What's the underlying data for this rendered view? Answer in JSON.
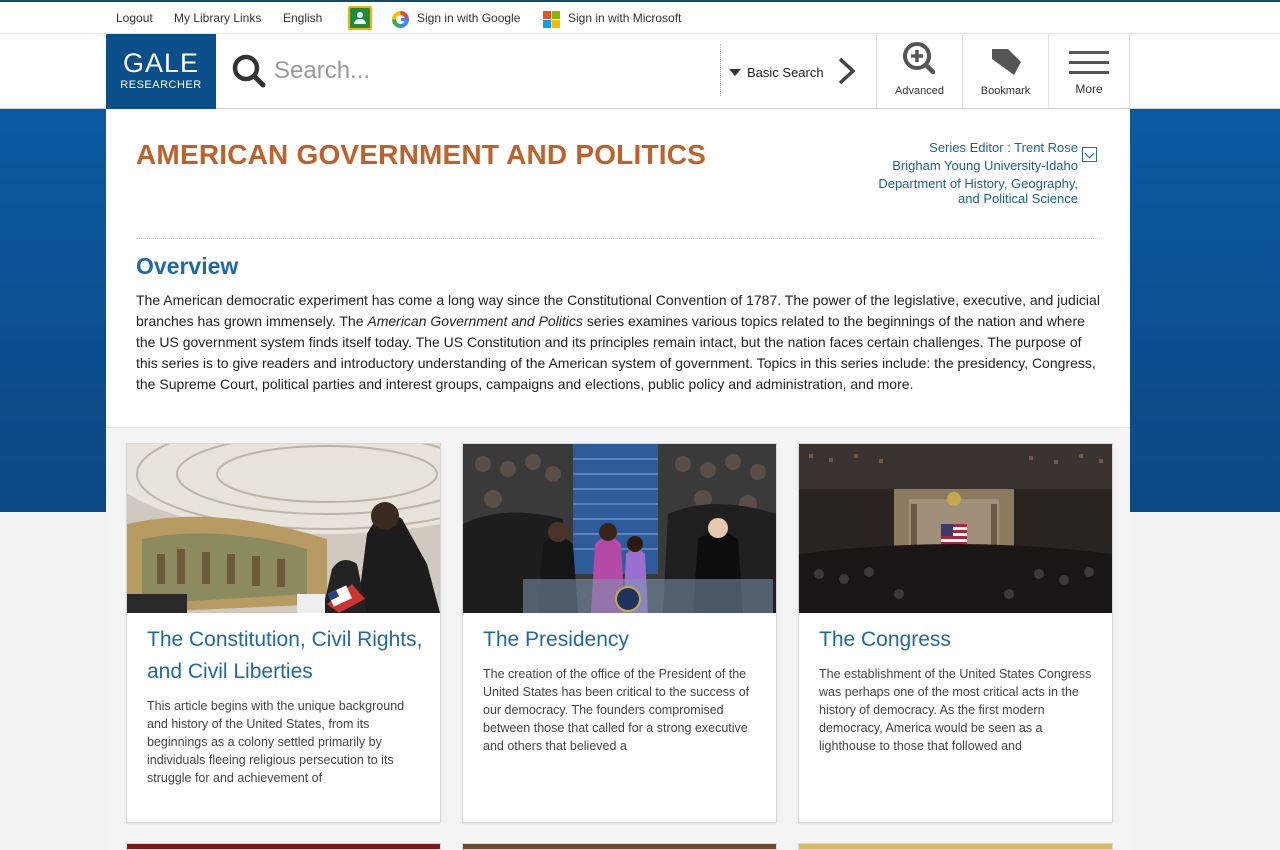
{
  "utility": {
    "logout": "Logout",
    "library_links": "My Library Links",
    "language": "English",
    "google_signin": "Sign in with Google",
    "microsoft_signin": "Sign in with Microsoft"
  },
  "header": {
    "logo_line1": "GALE",
    "logo_line2": "RESEARCHER",
    "search_placeholder": "Search...",
    "search_mode": "Basic Search",
    "advanced_label": "Advanced",
    "bookmark_label": "Bookmark",
    "more_label": "More"
  },
  "series": {
    "title": "AMERICAN GOVERNMENT AND POLITICS",
    "editor_line1": "Series Editor : Trent Rose",
    "editor_line2": "Brigham Young University-Idaho",
    "editor_line3": "Department of History, Geography,",
    "editor_line4": "and Political Science"
  },
  "overview": {
    "heading": "Overview",
    "text_part1": "The American democratic experiment has come a long way since the Constitutional Convention of 1787. The power of the legislative, executive, and judicial branches has grown immensely. The ",
    "text_italic": "American Government and Politics",
    "text_part2": " series examines various topics related to the beginnings of the nation and where the US government system finds itself today. The US Constitution and its principles remain intact, but the nation faces certain challenges. The purpose of this series is to give readers and introductory understanding of the American system of government. Topics in this series include: the presidency, Congress, the Supreme Court, political parties and interest groups, campaigns and elections, public policy and administration, and more."
  },
  "topics": [
    {
      "title": "The Constitution, Civil Rights, and Civil Liberties",
      "description": "This article begins with the unique background and history of the United States, from its beginnings as a colony settled primarily by individuals fleeing religious persecution to its struggle for and achievement of"
    },
    {
      "title": "The Presidency",
      "description": "The creation of the office of the President of the United States has been critical to the success of our democracy. The founders compromised between those that called for a strong executive and others that believed a"
    },
    {
      "title": "The Congress",
      "description": "The establishment of the United States Congress was perhaps one of the most critical acts in the history of democracy. As the first modern democracy, America would be seen as a lighthouse to those that followed and"
    }
  ],
  "colors": {
    "brand_blue": "#0a4f8a",
    "title_orange": "#c0612b",
    "link_blue": "#1e6aa8"
  },
  "icons": {
    "classroom": "google-classroom-icon",
    "google": "google-icon",
    "microsoft": "microsoft-icon",
    "search": "search-icon",
    "advanced": "zoom-plus-icon",
    "bookmark": "bookmark-icon",
    "more": "hamburger-menu-icon"
  }
}
